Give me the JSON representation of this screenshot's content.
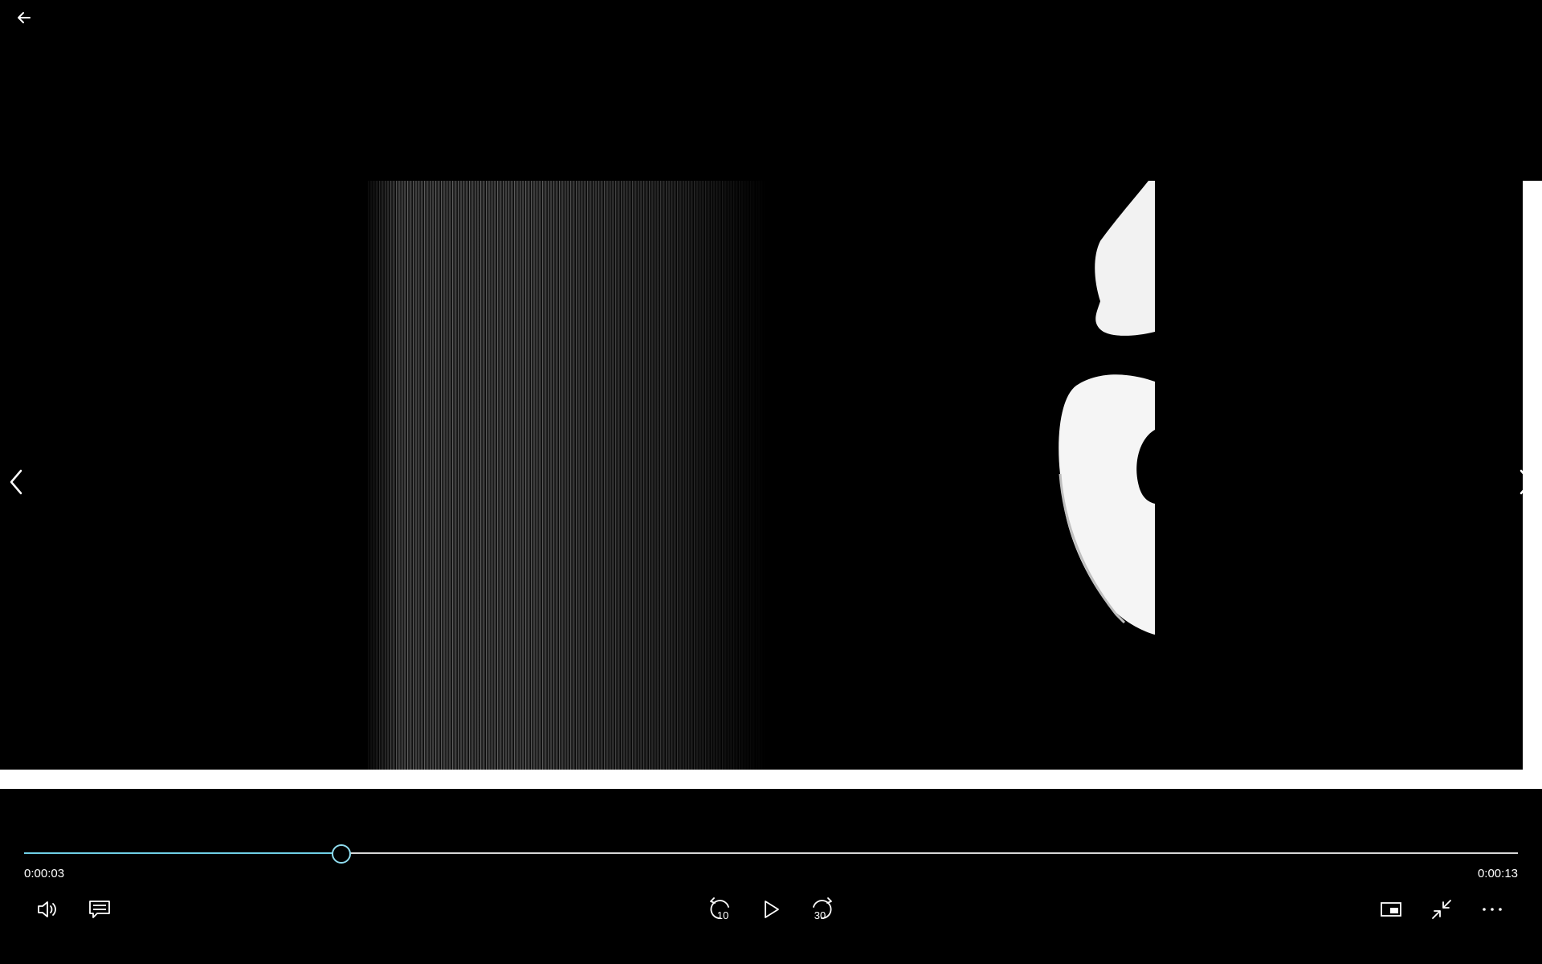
{
  "player": {
    "current_time": "0:00:03",
    "total_time": "0:00:13",
    "progress_fraction": 0.212,
    "accent_color": "#6fd0e6"
  },
  "icons": {
    "back": "arrow-left-icon",
    "previous": "chevron-left-icon",
    "next": "chevron-right-icon",
    "volume": "volume-icon",
    "captions": "captions-icon",
    "skip_back": "skip-back-10-icon",
    "play": "play-icon",
    "skip_forward": "skip-forward-30-icon",
    "mini_view": "mini-view-icon",
    "exit_fullscreen": "exit-fullscreen-icon",
    "more": "more-options-icon"
  },
  "controls": {
    "skip_back_seconds": "10",
    "skip_forward_seconds": "30"
  }
}
